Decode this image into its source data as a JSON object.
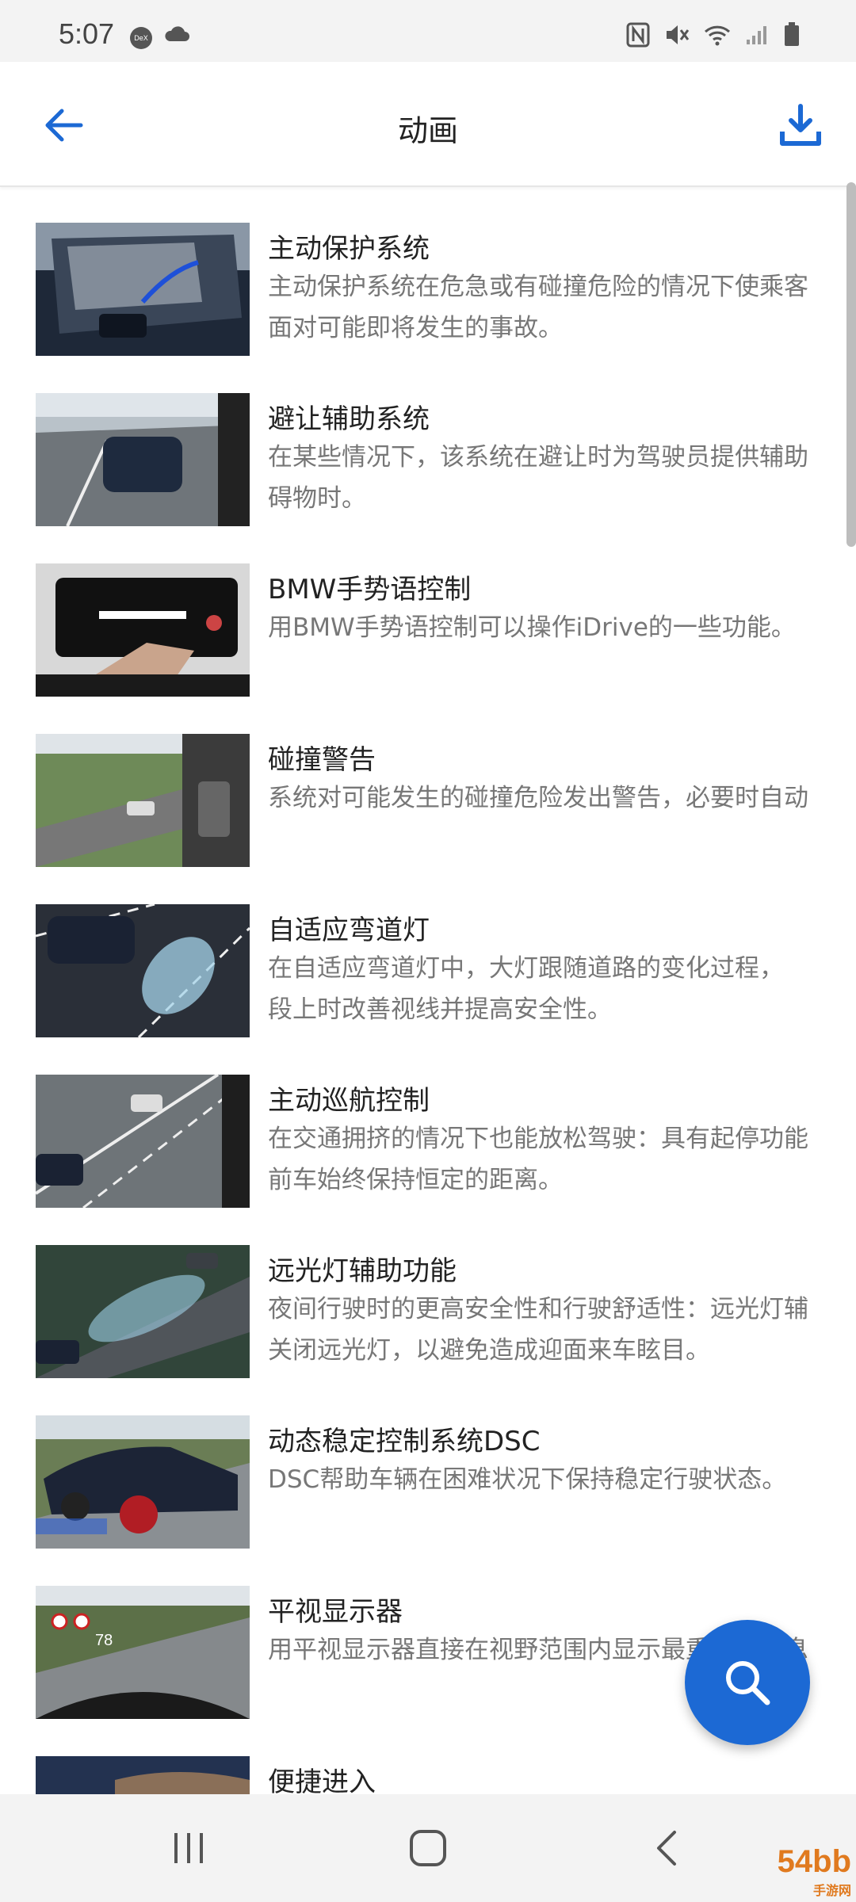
{
  "status": {
    "time": "5:07",
    "dex_label": "DeX"
  },
  "header": {
    "title": "动画"
  },
  "items": [
    {
      "title": "主动保护系统",
      "desc1": "主动保护系统在危急或有碰撞危险的情况下使乘客",
      "desc2": "面对可能即将发生的事故。"
    },
    {
      "title": "避让辅助系统",
      "desc1": "在某些情况下，该系统在避让时为驾驶员提供辅助",
      "desc2": "碍物时。"
    },
    {
      "title": "BMW手势语控制",
      "desc1": "用BMW手势语控制可以操作iDrive的一些功能。",
      "desc2": ""
    },
    {
      "title": "碰撞警告",
      "desc1": "系统对可能发生的碰撞危险发出警告，必要时自动",
      "desc2": ""
    },
    {
      "title": "自适应弯道灯",
      "desc1": "在自适应弯道灯中，大灯跟随道路的变化过程，",
      "desc2": "段上时改善视线并提高安全性。"
    },
    {
      "title": "主动巡航控制",
      "desc1": "在交通拥挤的情况下也能放松驾驶：具有起停功能",
      "desc2": "前车始终保持恒定的距离。"
    },
    {
      "title": "远光灯辅助功能",
      "desc1": "夜间行驶时的更高安全性和行驶舒适性：远光灯辅",
      "desc2": "关闭远光灯，以避免造成迎面来车眩目。"
    },
    {
      "title": "动态稳定控制系统DSC",
      "desc1": "DSC帮助车辆在困难状况下保持稳定行驶状态。",
      "desc2": ""
    },
    {
      "title": "平视显示器",
      "desc1": "用平视显示器直接在视野范围内显示最重要的信息",
      "desc2": ""
    },
    {
      "title": "便捷进入",
      "desc1": "",
      "desc2": ""
    }
  ],
  "watermark": {
    "text": "54bb",
    "sub": "手游网"
  },
  "colors": {
    "accent": "#1c69d4",
    "statusbar": "#f3f3f3"
  },
  "icons": {
    "back": "arrow-left-icon",
    "download": "download-icon",
    "search": "search-icon",
    "nav_recents": "recents-icon",
    "nav_home": "home-icon",
    "nav_back": "back-chevron-icon"
  }
}
